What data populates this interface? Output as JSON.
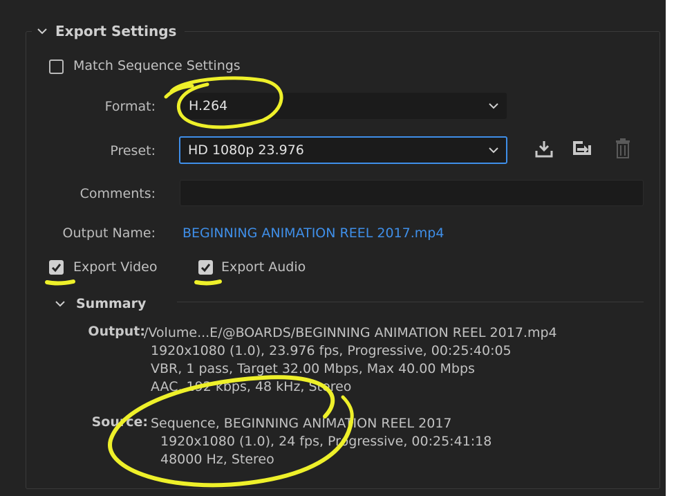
{
  "export_settings": {
    "title": "Export Settings",
    "match_sequence_label": "Match Sequence Settings",
    "match_sequence_checked": false,
    "format_label": "Format:",
    "format_value": "H.264",
    "preset_label": "Preset:",
    "preset_value": "HD 1080p 23.976",
    "comments_label": "Comments:",
    "comments_value": "",
    "output_name_label": "Output Name:",
    "output_name_value": "BEGINNING ANIMATION REEL 2017.mp4",
    "export_video_label": "Export Video",
    "export_video_checked": true,
    "export_audio_label": "Export Audio",
    "export_audio_checked": true,
    "icons": [
      "save-preset-icon",
      "import-preset-icon",
      "delete-preset-icon"
    ]
  },
  "summary": {
    "title": "Summary",
    "output_key": "Output:",
    "output_lines": [
      "/Volume...E/@BOARDS/BEGINNING ANIMATION REEL 2017.mp4",
      "1920x1080 (1.0), 23.976 fps, Progressive, 00:25:40:05",
      "VBR, 1 pass, Target 32.00 Mbps, Max 40.00 Mbps",
      "AAC, 192 kbps, 48 kHz, Stereo"
    ],
    "source_key": "Source:",
    "source_lines": [
      "Sequence, BEGINNING ANIMATION REEL 2017",
      "1920x1080 (1.0), 24 fps, Progressive, 00:25:41:18",
      "48000 Hz, Stereo"
    ]
  },
  "colors": {
    "panel_bg": "#232323",
    "field_bg": "#1b1b1b",
    "accent_blue": "#3f8fe9",
    "annotation_yellow": "#eef02a"
  }
}
